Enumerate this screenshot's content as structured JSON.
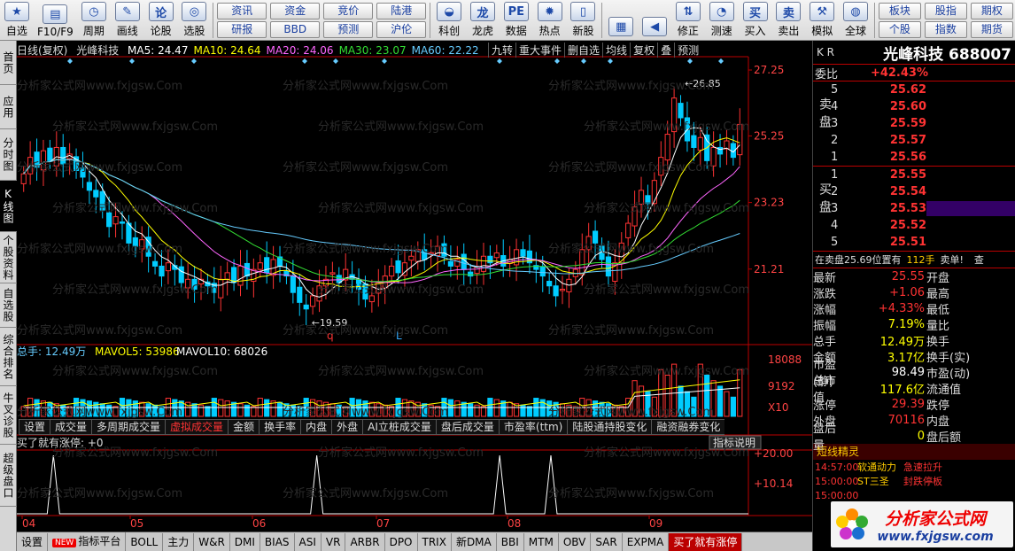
{
  "toolbar": {
    "buttons_left": [
      {
        "label": "自选",
        "icon": "star-icon"
      },
      {
        "label": "F10/F9",
        "icon": "f10-icon"
      },
      {
        "label": "周期",
        "icon": "clock-icon"
      },
      {
        "label": "画线",
        "icon": "pencil-icon"
      },
      {
        "label": "论股",
        "icon": "lun-icon"
      },
      {
        "label": "选股",
        "icon": "select-stock-icon"
      }
    ],
    "pairs": [
      {
        "top": "资讯",
        "bottom": "研报"
      },
      {
        "top": "资金",
        "bottom": "BBD"
      },
      {
        "top": "竞价",
        "bottom": "预测"
      },
      {
        "top": "陆港",
        "bottom": "沪伦"
      }
    ],
    "buttons_mid": [
      {
        "label": "科创",
        "icon": "kechuang-icon"
      },
      {
        "label": "龙虎",
        "icon": "dragon-tiger-icon"
      },
      {
        "label": "数据",
        "icon": "data-icon"
      },
      {
        "label": "热点",
        "icon": "hot-icon"
      },
      {
        "label": "新股",
        "icon": "new-stock-icon"
      }
    ],
    "buttons_right": [
      {
        "label": "",
        "icon": "windows-icon"
      },
      {
        "label": "",
        "icon": "back-arrow-icon"
      },
      {
        "label": "修正",
        "icon": "up-down-icon"
      },
      {
        "label": "测速",
        "icon": "speed-icon"
      },
      {
        "label": "买入",
        "icon": "buy-icon"
      },
      {
        "label": "卖出",
        "icon": "sell-icon"
      },
      {
        "label": "模拟",
        "icon": "gavel-icon"
      },
      {
        "label": "全球",
        "icon": "globe-icon"
      }
    ],
    "pairs_right": [
      {
        "top": "板块",
        "bottom": "个股"
      },
      {
        "top": "股指",
        "bottom": "指数"
      },
      {
        "top": "期权",
        "bottom": "期货"
      }
    ]
  },
  "left_tabs": [
    {
      "label": "首页",
      "active": false
    },
    {
      "label": "应用",
      "active": false
    },
    {
      "label": "分时图",
      "active": false
    },
    {
      "label": "K线图",
      "active": true
    },
    {
      "label": "个股资料",
      "active": false
    },
    {
      "label": "自选股",
      "active": false
    },
    {
      "label": "综合排名",
      "active": false
    },
    {
      "label": "牛叉诊股",
      "active": false
    },
    {
      "label": "超级盘口",
      "active": false
    }
  ],
  "chart_header": {
    "period": "日线(复权)",
    "name": "光峰科技",
    "ma": [
      {
        "label": "MA5: 24.47",
        "color": "#ffffff"
      },
      {
        "label": "MA10: 24.64",
        "color": "#ffff00"
      },
      {
        "label": "MA20: 24.06",
        "color": "#ff66ff"
      },
      {
        "label": "MA30: 23.07",
        "color": "#33dd33"
      },
      {
        "label": "MA60: 22.22",
        "color": "#66ccff"
      }
    ],
    "top_buttons": [
      "九转",
      "重大事件",
      "删自选",
      "均线",
      "复权",
      "叠",
      "预测"
    ]
  },
  "price_axis": [
    "27.25",
    "25.25",
    "23.23",
    "21.21"
  ],
  "volume_axis": [
    "18088",
    "9192",
    "X10"
  ],
  "indicator_axis": [
    "+20.00",
    "+10.14"
  ],
  "date_axis": [
    "04",
    "05",
    "06",
    "07",
    "08",
    "09"
  ],
  "annotations": {
    "high": "26.85",
    "low": "19.59",
    "mark_q": "q",
    "mark_l": "L"
  },
  "volume_header": {
    "total": "总手: 12.49万",
    "mavol5": "MAVOL5: 53986",
    "mavol10": "MAVOL10: 68026"
  },
  "sub_tabs": [
    "设置",
    "成交量",
    "多周期成交量",
    "虚拟成交量",
    "金额",
    "换手率",
    "内盘",
    "外盘",
    "AI立桩成交量",
    "盘后成交量",
    "市盈率(ttm)",
    "陆股通持股变化",
    "融资融券变化"
  ],
  "sub_tab_active": "虚拟成交量",
  "indicator_header": {
    "label": "买了就有涨停: +0",
    "button": "指标说明"
  },
  "bottom_tabs": [
    "设置",
    "指标平台",
    "BOLL",
    "主力",
    "W&R",
    "DMI",
    "BIAS",
    "ASI",
    "VR",
    "ARBR",
    "DPO",
    "TRIX",
    "新DMA",
    "BBI",
    "MTM",
    "OBV",
    "SAR",
    "EXPMA",
    "买了就有涨停"
  ],
  "bottom_new_badge": "NEW",
  "watermark": "分析家公式网www.fxjgsw.Com",
  "right": {
    "kr": "K R",
    "title": "光峰科技 688007",
    "weibi_label": "委比",
    "weibi_value": "+42.43%",
    "sell_label": "卖盘",
    "buy_label": "买盘",
    "sells": [
      {
        "idx": "5",
        "price": "25.62"
      },
      {
        "idx": "4",
        "price": "25.60"
      },
      {
        "idx": "3",
        "price": "25.59"
      },
      {
        "idx": "2",
        "price": "25.57"
      },
      {
        "idx": "1",
        "price": "25.56"
      }
    ],
    "buys": [
      {
        "idx": "1",
        "price": "25.55"
      },
      {
        "idx": "2",
        "price": "25.54"
      },
      {
        "idx": "3",
        "price": "25.53"
      },
      {
        "idx": "4",
        "price": "25.52"
      },
      {
        "idx": "5",
        "price": "25.51"
      }
    ],
    "order_line": {
      "text": "在卖盘25.69位置有",
      "qty": "112手",
      "tag": "卖单!",
      "end": "查"
    },
    "stats": [
      {
        "k": "最新",
        "v": "25.55",
        "k2": "开盘",
        "color": "#ff3333"
      },
      {
        "k": "涨跌",
        "v": "+1.06",
        "k2": "最高",
        "color": "#ff3333"
      },
      {
        "k": "涨幅",
        "v": "+4.33%",
        "k2": "最低",
        "color": "#ff3333"
      },
      {
        "k": "振幅",
        "v": "7.19%",
        "k2": "量比",
        "color": "#ffff00"
      },
      {
        "k": "总手",
        "v": "12.49万",
        "k2": "换手",
        "color": "#ffff00"
      },
      {
        "k": "金额",
        "v": "3.17亿",
        "k2": "换手(实)",
        "color": "#ffff00"
      },
      {
        "k": "市盈(静)",
        "v": "98.49",
        "k2": "市盈(动)",
        "color": "#ffffff"
      },
      {
        "k": "总市值",
        "v": "117.6亿",
        "k2": "流通值",
        "color": "#ffff00"
      },
      {
        "k": "涨停",
        "v": "29.39",
        "k2": "跌停",
        "color": "#ff3333"
      },
      {
        "k": "外盘",
        "v": "70116",
        "k2": "内盘",
        "color": "#ff3333"
      },
      {
        "k": "盘后量",
        "v": "0",
        "k2": "盘后额",
        "color": "#ffff00"
      }
    ],
    "alerts_title": "短线精灵",
    "alerts": [
      {
        "t": "14:57:00",
        "s": "软通动力",
        "e": "急速拉升"
      },
      {
        "t": "15:00:00",
        "s": "ST三圣",
        "e": "封跌停板"
      },
      {
        "t": "15:00:00",
        "s": "",
        "e": ""
      }
    ],
    "logo_main": "分析家公式网",
    "logo_url": "www.fxjgsw.com"
  },
  "chart_data": {
    "type": "candlestick",
    "title": "光峰科技 日线(复权)",
    "ylim": [
      19.0,
      27.6
    ],
    "x_months": [
      "04",
      "05",
      "06",
      "07",
      "08",
      "09"
    ],
    "colors": {
      "up": "#ff3333",
      "down": "#00ccff",
      "ma5": "#ffffff",
      "ma10": "#ffff00",
      "ma20": "#ff66ff",
      "ma30": "#33dd33",
      "ma60": "#66ccff"
    },
    "close": [
      24.1,
      24.6,
      24.3,
      24.8,
      24.5,
      24.9,
      24.4,
      24.7,
      24.2,
      24.0,
      23.6,
      23.4,
      23.0,
      22.5,
      22.8,
      22.6,
      22.0,
      21.9,
      22.1,
      21.6,
      21.3,
      21.0,
      21.4,
      21.2,
      20.8,
      20.9,
      20.6,
      20.9,
      20.7,
      20.5,
      20.9,
      21.1,
      20.8,
      21.3,
      21.0,
      21.2,
      21.4,
      21.1,
      21.5,
      21.3,
      21.0,
      20.5,
      20.2,
      20.0,
      20.4,
      20.7,
      20.9,
      21.1,
      20.8,
      21.2,
      20.9,
      20.6,
      20.3,
      20.4,
      20.8,
      21.0,
      21.3,
      21.1,
      21.4,
      21.6,
      21.8,
      21.5,
      21.7,
      21.9,
      21.6,
      21.3,
      21.5,
      21.2,
      21.0,
      21.3,
      21.6,
      21.4,
      21.7,
      21.3,
      21.5,
      21.8,
      21.6,
      21.4,
      21.2,
      21.0,
      20.7,
      20.4,
      20.6,
      20.9,
      21.2,
      21.8,
      22.2,
      22.0,
      21.5,
      21.0,
      21.4,
      22.0,
      22.6,
      23.1,
      23.6,
      23.2,
      23.9,
      24.6,
      25.3,
      26.4,
      25.8,
      25.1,
      24.9,
      25.2,
      24.5,
      24.9,
      24.7,
      25.1,
      24.6,
      25.6
    ],
    "volume_scale": [
      18088,
      9192
    ],
    "indicator_peaks_at_month_frac": [
      0.05,
      0.41,
      0.66,
      0.73
    ]
  }
}
